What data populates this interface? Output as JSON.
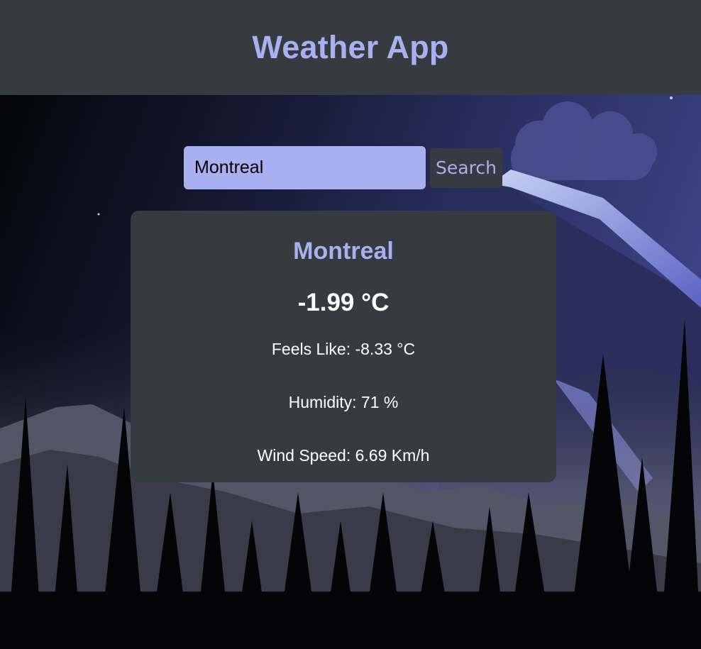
{
  "header": {
    "title": "Weather App"
  },
  "search": {
    "value": "Montreal",
    "button_label": "Search"
  },
  "weather": {
    "city": "Montreal",
    "temperature": "-1.99 °C",
    "feels_like": "Feels Like: -8.33 °C",
    "humidity": "Humidity: 71 %",
    "wind_speed": "Wind Speed: 6.69 Km/h"
  },
  "colors": {
    "accent": "#a9afef",
    "header_bg": "#363a41",
    "card_bg": "#363a41",
    "input_bg": "#a9b0f1"
  }
}
